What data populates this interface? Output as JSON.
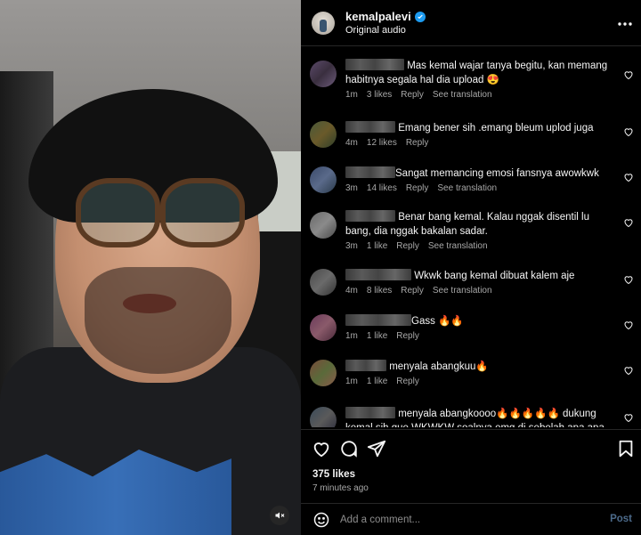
{
  "video": {
    "mute_icon": "speaker-muted-icon"
  },
  "header": {
    "username": "kemalpalevi",
    "audio": "Original audio",
    "more_icon": "more-horizontal-icon",
    "verified_icon": "verified-badge-icon"
  },
  "comments": [
    {
      "text": "Mas kemal wajar tanya begitu, kan memang habitnya segala hal dia upload 😍",
      "time": "1m",
      "likes": "3 likes",
      "reply": "Reply",
      "translate": "See translation"
    },
    {
      "text": "Emang bener sih .emang bleum uplod juga",
      "time": "4m",
      "likes": "12 likes",
      "reply": "Reply",
      "translate": ""
    },
    {
      "text": "Sangat memancing emosi fansnya awowkwk",
      "time": "3m",
      "likes": "14 likes",
      "reply": "Reply",
      "translate": "See translation"
    },
    {
      "text": "Benar bang kemal. Kalau nggak disentil lu bang, dia nggak bakalan sadar.",
      "time": "3m",
      "likes": "1 like",
      "reply": "Reply",
      "translate": "See translation"
    },
    {
      "text": "Wkwk bang kemal dibuat kalem aje",
      "time": "4m",
      "likes": "8 likes",
      "reply": "Reply",
      "translate": "See translation"
    },
    {
      "text": "Gass 🔥🔥",
      "time": "1m",
      "likes": "1 like",
      "reply": "Reply",
      "translate": ""
    },
    {
      "text": "menyala abangkuu🔥",
      "time": "1m",
      "likes": "1 like",
      "reply": "Reply",
      "translate": ""
    },
    {
      "text": "menyala abangkoooo🔥🔥🔥🔥🔥 dukung kemal sih gue WKWKW soalnya emg di sebelah apa apa konten jd",
      "time": "",
      "likes": "",
      "reply": "",
      "translate": ""
    }
  ],
  "post": {
    "likes": "375 likes",
    "time_ago": "7 minutes ago"
  },
  "composer": {
    "placeholder": "Add a comment...",
    "post_label": "Post"
  },
  "colors": {
    "accent": "#0095f6",
    "verified": "#1d9bf0",
    "muted_text": "#a8a8a8"
  }
}
